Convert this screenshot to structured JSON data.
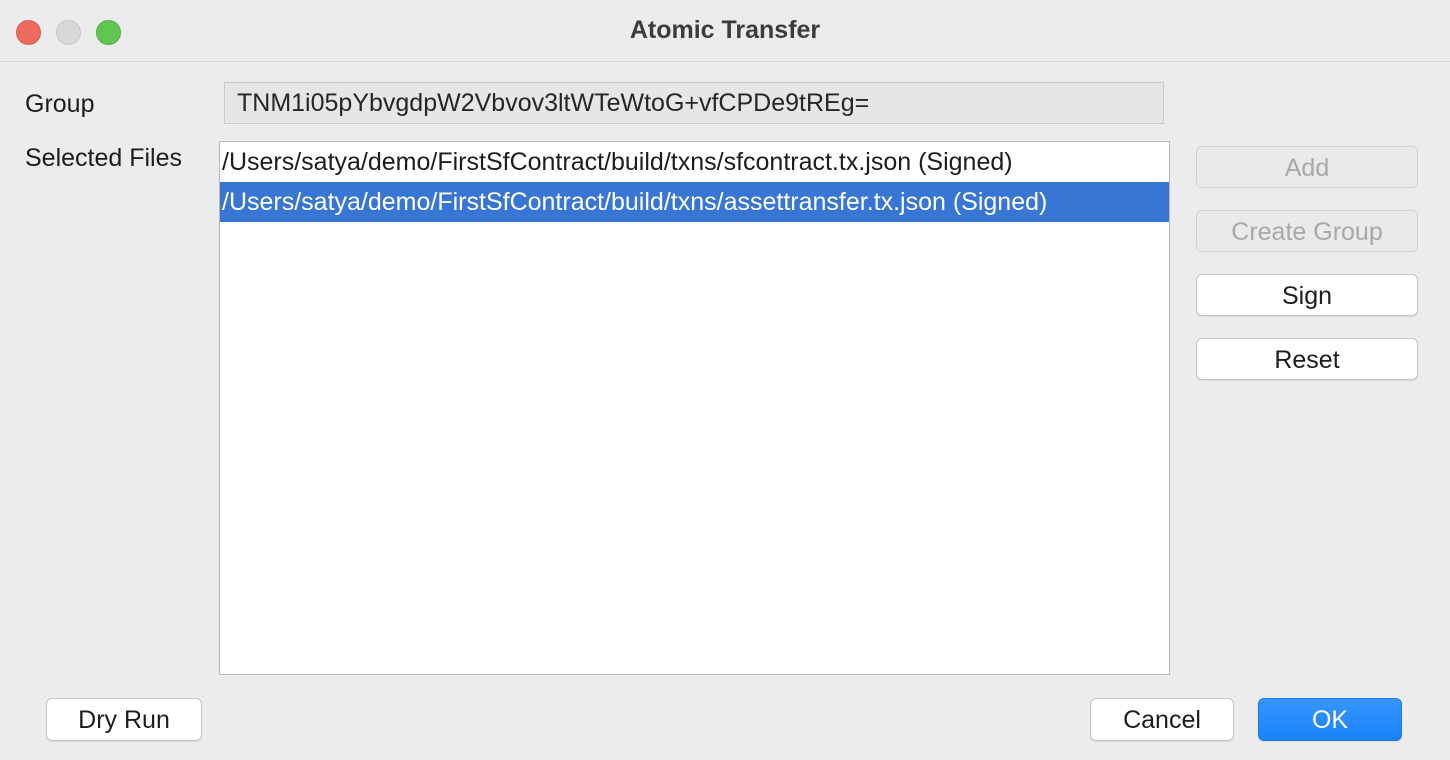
{
  "window": {
    "title": "Atomic Transfer"
  },
  "group": {
    "label": "Group",
    "value": "TNM1i05pYbvgdpW2Vbvov3ltWTeWtoG+vfCPDe9tREg="
  },
  "files": {
    "label": "Selected Files",
    "items": [
      {
        "text": "/Users/satya/demo/FirstSfContract/build/txns/sfcontract.tx.json  (Signed)",
        "selected": false
      },
      {
        "text": "/Users/satya/demo/FirstSfContract/build/txns/assettransfer.tx.json  (Signed)",
        "selected": true
      }
    ]
  },
  "side_buttons": {
    "add": "Add",
    "create_group": "Create Group",
    "sign": "Sign",
    "reset": "Reset"
  },
  "footer": {
    "dry_run": "Dry Run",
    "cancel": "Cancel",
    "ok": "OK"
  },
  "colors": {
    "selection": "#3876d6",
    "primary_button": "#1f88ff",
    "close": "#ed6a5e",
    "minimize": "#d9d8d9",
    "maximize": "#61c554"
  }
}
